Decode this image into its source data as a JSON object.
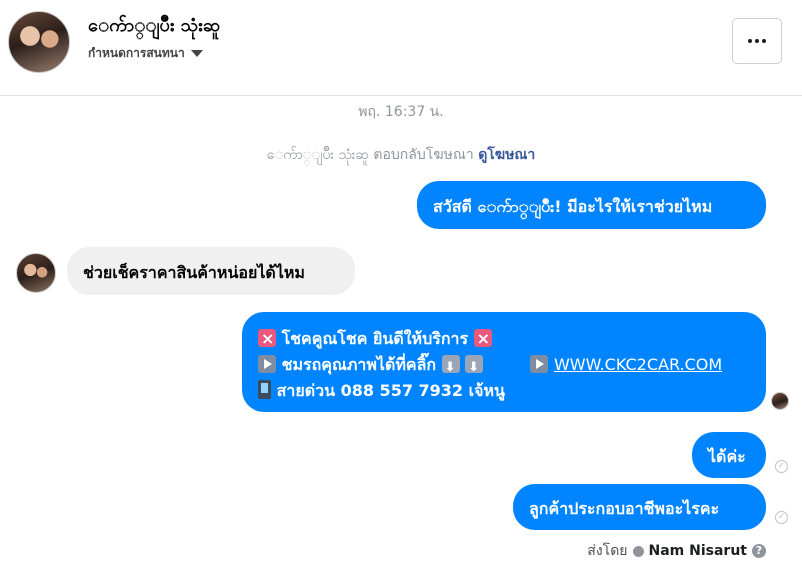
{
  "header": {
    "contact_name": "ေက်ာ္ျပိဳး သုံးဆူ",
    "nickname_label": "กำหนดการสนทนา",
    "more_label": "•••"
  },
  "thread": {
    "timestamp": "พฤ. 16:37 น.",
    "replied_prefix": "ေက်ာ္ျပိဳး သုံးဆူ ตอบกลับโฆษณา",
    "replied_link": "ดูโฆษณา",
    "messages": {
      "greeting": "สวัสดี ေက်ာ္ျပိဳး! มีอะไรให้เราช่วยไหม",
      "customer_question": "ช่วยเช็คราคาสินค้าหน่อยได้ไหม",
      "promo_line1": "โชคคูณโชค ยินดีให้บริการ",
      "promo_line2": "ชมรถคุณภาพได้ที่คลิ๊ก",
      "promo_url": "WWW.CKC2CAR.COM",
      "promo_line3": "สายด่วน 088 557 7932 เจ้หนู",
      "reply_ok": "ได้ค่ะ",
      "reply_occupation": "ลูกค้าประกอบอาชีพอะไรคะ"
    },
    "sent_by_label": "ส่งโดย",
    "sent_by_name": "Nam Nisarut",
    "help_label": "?"
  },
  "colors": {
    "accent": "#0084ff",
    "incoming_bubble": "#f1f0f0",
    "meta_text": "#90949c",
    "link": "#385898"
  }
}
